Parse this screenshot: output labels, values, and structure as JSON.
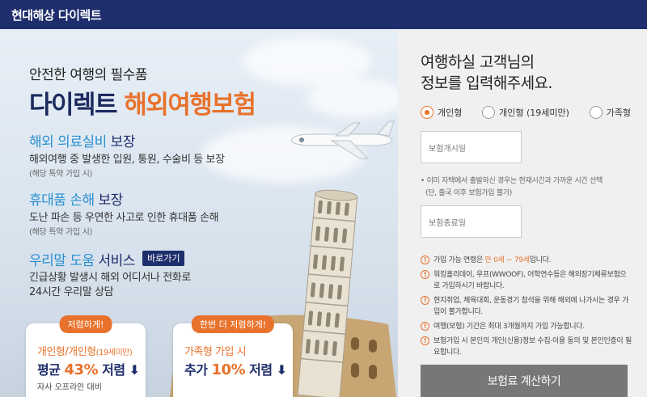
{
  "header": {
    "brand": "현대해상 다이렉트"
  },
  "hero": {
    "pre_title": "안전한 여행의 필수품",
    "title_main": "다이렉트 ",
    "title_accent": "해외여행보험",
    "features": [
      {
        "title_hl": "해외 의료실비",
        "title_rest": " 보장",
        "desc": "해외여행 중 발생한 입원, 통원, 수술비 등 보장",
        "note": "(해당 특약 가입 시)"
      },
      {
        "title_hl": "휴대품 손해",
        "title_rest": " 보장",
        "desc": "도난 파손 등 우연한 사고로 인한 휴대품 손해",
        "note": "(해당 특약 가입 시)"
      },
      {
        "title_hl": "우리말 도움",
        "title_rest": " 서비스",
        "desc": "긴급상황 발생시 해외 어디서나 전화로",
        "desc2": "24시간 우리말 상담"
      }
    ],
    "go_button": "바로가기",
    "cards": [
      {
        "badge": "저렴하게!",
        "line1": "개인형/개인형",
        "line1_small": "(19세미만)",
        "line2_pre": "평균 ",
        "line2_pct": "43%",
        "line2_post": " 저렴 ⬇",
        "line3": "자사 오프라인 대비"
      },
      {
        "badge": "한번 더 저렴하게!",
        "line1": "가족형 가입 시",
        "line2_pre": "추가 ",
        "line2_pct": "10%",
        "line2_post": " 저렴 ⬇"
      }
    ]
  },
  "panel": {
    "title_line1": "여행하실 고객님의",
    "title_line2": "정보를 입력해주세요.",
    "radios": [
      {
        "label": "개인형",
        "checked": true
      },
      {
        "label": "개인형 (19세미만)",
        "checked": false
      },
      {
        "label": "가족형",
        "checked": false
      }
    ],
    "start_placeholder": "보험개시일",
    "note_line1": "• 이미 자택에서 출발하신 경우는 현재시간과 가까운 시간 선택",
    "note_line2": "(단, 출국 이후 보험가입 불가)",
    "end_placeholder": "보험종료일",
    "info": [
      {
        "pre": "가입 가능 연령은 ",
        "hl": "만 0세 ~ 79세",
        "post": "입니다."
      },
      {
        "pre": "워킹홀리데이, 우프(WWOOF), 어학연수등은 해외장기체류보험으로 가입하시기 바랍니다."
      },
      {
        "pre": "현지취업, 체육대회, 운동경기 참석을 위해 해외에 나가시는 경우 가입이 불가합니다."
      },
      {
        "pre": "여행(보험) 기간은 최대 3개월까지 가입 가능합니다."
      },
      {
        "pre": "보험가입 시 본인의 개인(신용)정보 수집·이용 동의 및 본인인증이 필요합니다."
      }
    ],
    "calc_button": "보험료 계산하기"
  }
}
